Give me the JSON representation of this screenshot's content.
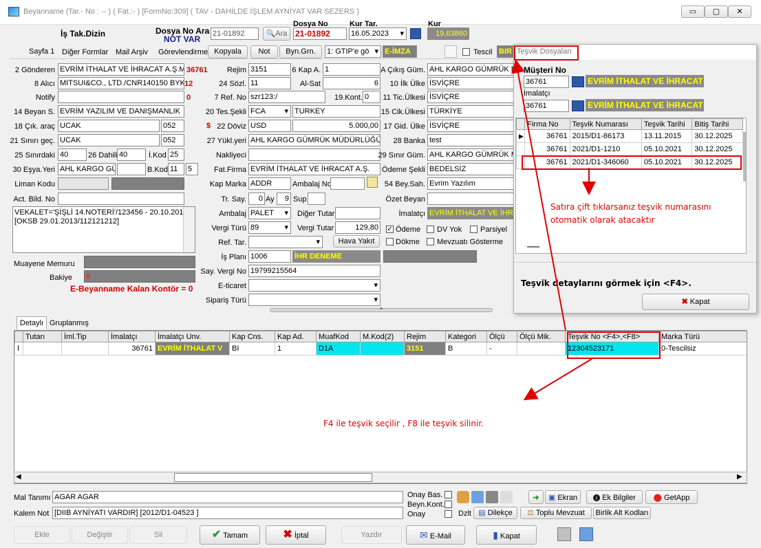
{
  "window": {
    "title": "Beyanname (Tar.- No : -- ) ( Fat.:- ) [FormNo:309] ( TAV - DAHİLDE İŞLEM AYNİYAT VAR SEZERS )"
  },
  "header": {
    "is_takip": "İş Tak.Dizin",
    "dosya_no_ara_label": "Dosya No Ara",
    "not_var": "NOT VAR",
    "ara_value": "21-01892",
    "ara_btn": "Ara",
    "dosya_no_label": "Dosya No",
    "dosya_no": "21-01892",
    "kur_tar_label": "Kur Tar.",
    "kur_tar": "16.05.2023",
    "kur_label": "Kur",
    "kur": "19,63860"
  },
  "toolbar": {
    "sayfa1": "Sayfa 1",
    "diger_formlar": "Diğer Formlar",
    "mail_arsiv": "Mail Arşiv",
    "gorevlendirme": "Görevlendirme",
    "kopyala": "Kopyala",
    "not": "Not",
    "byn_grn": "Byn.Grn.",
    "gtip": "1: GTIP'e gö",
    "eimza": "E-İMZA",
    "tescil": "Tescil",
    "bir": "BIR"
  },
  "form": {
    "gonderen_label": "2 Gönderen",
    "gonderen": "EVRİM İTHALAT VE İHRACAT A.Ş.M",
    "gonderen_code": "36761",
    "alici_label": "8 Alıcı",
    "alici": "MITSUI&CO., LTD./CNR140150 BYK",
    "alici_code": "12",
    "notify_label": "Notify",
    "notify_code": "0",
    "beyan_label": "14 Beyan S.",
    "beyan": "EVRİM YAZILIM VE DANIŞMANLIK",
    "cik_arac_label": "18 Çık. araç",
    "cik_arac": "UCAK",
    "cik_arac_code": "052",
    "sinir_gec_label": "21 Sınırı geç.",
    "sinir_gec": "UCAK",
    "sinir_gec_code": "052",
    "sinirdaki_label": "25 Sınırdaki",
    "sinirdaki": "40",
    "dahili_label": "26 Dahili",
    "dahili": "40",
    "ikod_label": "İ.Kod",
    "ikod": "25",
    "esya_yeri_label": "30 Eşya.Yeri",
    "esya_yeri": "AHL KARGO GÜ",
    "bkod_label": "B.Kod",
    "bkod": "11",
    "bkod2": "5",
    "liman_label": "Liman Kodu",
    "act_label": "Act. Bild. No",
    "memo": "VEKALET='ŞİŞLİ 14.NOTERİ'/123456 - 20.10.2011' [OKSB 29.01.2013/112121212]",
    "muayene_label": "Muayene Memuru",
    "bakiye_label": "Bakiye",
    "bakiye": "0",
    "kontor": "E-Beyanname Kalan Kontör = 0",
    "rejim_label": "Rejim",
    "rejim": "3151",
    "kapa_label": "6 Kap A.",
    "kapa": "1",
    "sozl_label": "24 Sözl.",
    "sozl": "11",
    "alsat_label": "Al-Sat",
    "alsat": "6",
    "refno_label": "7 Ref. No",
    "refno": "szr123:/",
    "kont_label": "19.Kont.",
    "kont": "0",
    "tes_label": "20 Tes.Şekli",
    "tes": "FCA",
    "tes_country": "TURKEY",
    "doviz_label": "22 Döviz",
    "doviz": "USD",
    "doviz_amount": "5.000,00",
    "yukl_label": "27 Yükl.yeri",
    "yukl": "AHL KARGO GÜMRÜK MÜDÜRLÜĞÜ",
    "nakliyeci_label": "Nakliyeci",
    "fatfirma_label": "Fat.Firma",
    "fatfirma": "EVRİM İTHALAT VE İHRACAT A.Ş.",
    "kapmarka_label": "Kap Marka",
    "kapmarka": "ADDR",
    "ambalajno_label": "Ambalaj No",
    "tr_label": "Tr. Say.",
    "tr": "0",
    "ay_label": "Ay",
    "ay": "9",
    "sup_label": "Sup",
    "ambalaj_label": "Ambalaj",
    "ambalaj": "PALET",
    "diger_tutar_label": "Diğer Tutar",
    "vergi_turu_label": "Vergi Türü",
    "vergi_turu": "89",
    "vergi_tutar_label": "Vergi Tutar",
    "vergi_tutar": "129,80",
    "reftar_label": "Ref. Tar.",
    "hava_yakit": "Hava Yakıt",
    "isplani_label": "İş Planı",
    "isplani": "1006",
    "isplani_name": "İHR DENEME",
    "sayvergi_label": "Say. Vergi No",
    "sayvergi": "19799215564",
    "eticaret_label": "E-ticaret",
    "siparis_label": "Sipariş Türü",
    "cikis_label": "A Çıkış Güm.",
    "cikis": "AHL KARGO GÜMRÜK M",
    "ilk_ulke_label": "10 İlk Ülke",
    "ilk_ulke": "İSVİÇRE",
    "tic_ulke_label": "11 Tic.Ülkesi",
    "tic_ulke": "İSVİÇRE",
    "cik_ulke_label": "15 Cik.Ülkesi",
    "cik_ulke": "TÜRKİYE",
    "gid_ulke_label": "17 Gid. Ülke",
    "gid_ulke": "İSVİÇRE",
    "banka_label": "28 Banka",
    "banka": "test",
    "sinir_gum_label": "29 Sınır Güm.",
    "sinir_gum": "AHL KARGO GÜMRÜK M",
    "odeme_label": "Ödeme Şekli",
    "odeme": "BEDELSİZ",
    "beysah_label": "54 Bey.Sah.",
    "beysah": "Evrim Yazılım",
    "ozet_label": "Özet Beyan",
    "imalatci_label": "İmalatçı",
    "imalatci": "EVRİM İTHALAT VE İHR",
    "odeme_chk": "Ödeme",
    "dvyok": "DV Yok",
    "parsiyel": "Parsiyel",
    "dokme": "Dökme",
    "mevzuati": "Mevzuatı Gösterme"
  },
  "popup": {
    "title": "Teşvik Dosyaları",
    "musteri_label": "Müşteri No",
    "musteri": "36761",
    "musteri_name": "EVRİM İTHALAT VE İHRACAT",
    "imalatci_label": "İmalatçı",
    "imalatci": "36761",
    "imalatci_name": "EVRİM İTHALAT VE İHRACAT",
    "columns": [
      "Firma No",
      "Teşvik Numarası",
      "Teşvik Tarihi",
      "Bitiş Tarihi"
    ],
    "rows": [
      [
        "36761",
        "2015/D1-86173",
        "13.11.2015",
        "30.12.2025"
      ],
      [
        "36761",
        "2021/D1-1210",
        "05.10.2021",
        "30.12.2025"
      ],
      [
        "36761",
        "2021/D1-346060",
        "05.10.2021",
        "30.12.2025"
      ]
    ],
    "hint": "Teşvik detaylarını görmek için <F4>.",
    "kapat": "Kapat"
  },
  "annotations": {
    "dbl_click": "Satıra çift tıklarsanız teşvik numarasını otomatik olarak atacaktır",
    "f4f8": "F4 ile teşvik seçilir , F8 ile teşvik silinir."
  },
  "detail": {
    "tabs": [
      "Detaylı",
      "Gruplanmış"
    ],
    "columns": [
      "Tutarı",
      "İml.Tip",
      "İmalatçı",
      "İmalatçı Unv.",
      "Kap Cns.",
      "Kap Ad.",
      "MuafKod",
      "M.Kod(2)",
      "Rejim",
      "Kategori",
      "Ölçü",
      "Ölçü Mik.",
      "Teşvik No <F4>,<F8>",
      "Marka Türü"
    ],
    "row": [
      "",
      "",
      "36761",
      "EVRİM İTHALAT V",
      "BI",
      "1",
      "D1A",
      "",
      "3151",
      "B",
      "-",
      "",
      "12304523171",
      "0-Tescilsiz"
    ],
    "row_marker": "I"
  },
  "bottom": {
    "mal_label": "Mal Tanımı",
    "mal": "AGAR AGAR",
    "kalem_label": "Kalem Not",
    "kalem": "[DIIB AYNİYATI VARDIR] [2012/D1-04523 ]",
    "onay_bas": "Onay Bas.",
    "beyn_kont": "Beyn.Kont.",
    "onay": "Onay",
    "ekran": "Ekran",
    "ek_bilgiler": "Ek Bilgiler",
    "getapp": "GetApp",
    "dzlt": "Dzlt",
    "dilekce": "Dilekçe",
    "toplu": "Toplu Mevzuat",
    "birlik": "Birlik Alt Kodları",
    "ekle": "Ekle",
    "degistir": "Değiştir",
    "sil": "Sil",
    "tamam": "Tamam",
    "iptal": "İptal",
    "yazdir": "Yazdır",
    "email": "E-Mail",
    "kapat": "Kapat"
  },
  "colors": {
    "accent_red": "#e00000",
    "cyan": "#00e5ee",
    "yellow_text": "#ffff00"
  }
}
